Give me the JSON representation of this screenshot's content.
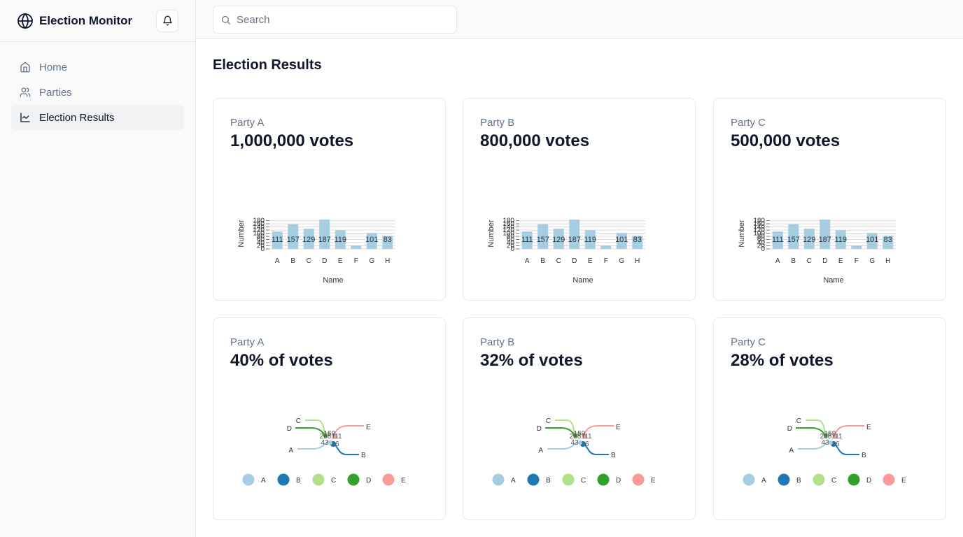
{
  "app": {
    "title": "Election Monitor"
  },
  "sidebar": {
    "items": [
      {
        "label": "Home",
        "icon": "home-icon",
        "active": false
      },
      {
        "label": "Parties",
        "icon": "users-icon",
        "active": false
      },
      {
        "label": "Election Results",
        "icon": "line-chart-icon",
        "active": true
      }
    ]
  },
  "search": {
    "placeholder": "Search",
    "value": ""
  },
  "page": {
    "title": "Election Results"
  },
  "cards": [
    {
      "label": "Party A",
      "value": "1,000,000 votes",
      "chart": "bar"
    },
    {
      "label": "Party B",
      "value": "800,000 votes",
      "chart": "bar"
    },
    {
      "label": "Party C",
      "value": "500,000 votes",
      "chart": "bar"
    },
    {
      "label": "Party A",
      "value": "40% of votes",
      "chart": "bump"
    },
    {
      "label": "Party B",
      "value": "32% of votes",
      "chart": "bump"
    },
    {
      "label": "Party C",
      "value": "28% of votes",
      "chart": "bump"
    }
  ],
  "colors": {
    "bar": "#a6cee3",
    "A": "#a6cee3",
    "B": "#1f78b4",
    "C": "#b2df8a",
    "D": "#33a02c",
    "E": "#fb9a99"
  },
  "chart_data": [
    {
      "type": "bar",
      "categories": [
        "A",
        "B",
        "C",
        "D",
        "E",
        "F",
        "G",
        "H"
      ],
      "values": [
        111,
        157,
        129,
        187,
        119,
        22,
        101,
        83
      ],
      "data_labels": [
        "111",
        "157",
        "129",
        "187",
        "119",
        "",
        "101",
        "83"
      ],
      "xlabel": "Name",
      "ylabel": "Number",
      "yticks": [
        0,
        20,
        40,
        60,
        80,
        100,
        120,
        140,
        160,
        180
      ],
      "ylim": [
        0,
        187
      ]
    },
    {
      "type": "bump",
      "series": [
        {
          "name": "A",
          "value": 43
        },
        {
          "name": "B",
          "value": 26
        },
        {
          "name": "C",
          "value": 159
        },
        {
          "name": "D",
          "value": 288
        },
        {
          "name": "E",
          "value": 111
        }
      ],
      "value_labels": [
        "288",
        "159",
        "111",
        "43",
        "26"
      ],
      "legend": [
        "A",
        "B",
        "C",
        "D",
        "E"
      ]
    }
  ]
}
